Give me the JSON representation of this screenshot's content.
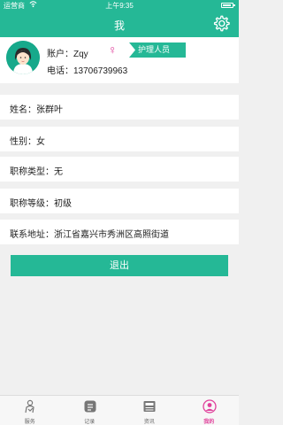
{
  "status_bar": {
    "carrier": "运营商",
    "time": "上午9:35",
    "battery_level": 0.85
  },
  "nav": {
    "title": "我",
    "settings_icon": "gear-icon"
  },
  "profile": {
    "account_label": "账户：Zqy",
    "phone_label": "电话：13706739963",
    "gender_symbol": "♀",
    "role_badge": "护理人员",
    "avatar_icon": "female-avatar-icon"
  },
  "info": {
    "name": "姓名：张群叶",
    "gender": "性别：女",
    "title_type": "职称类型：无",
    "title_level": "职称等级：初级",
    "address": "联系地址：浙江省嘉兴市秀洲区高照街道"
  },
  "logout_label": "退出",
  "tabs": [
    {
      "label": "服务",
      "icon": "service-icon",
      "active": false
    },
    {
      "label": "记录",
      "icon": "record-icon",
      "active": false
    },
    {
      "label": "资讯",
      "icon": "news-icon",
      "active": false
    },
    {
      "label": "我的",
      "icon": "user-icon",
      "active": true
    }
  ],
  "colors": {
    "brand": "#25b896",
    "accent": "#e0409b"
  }
}
